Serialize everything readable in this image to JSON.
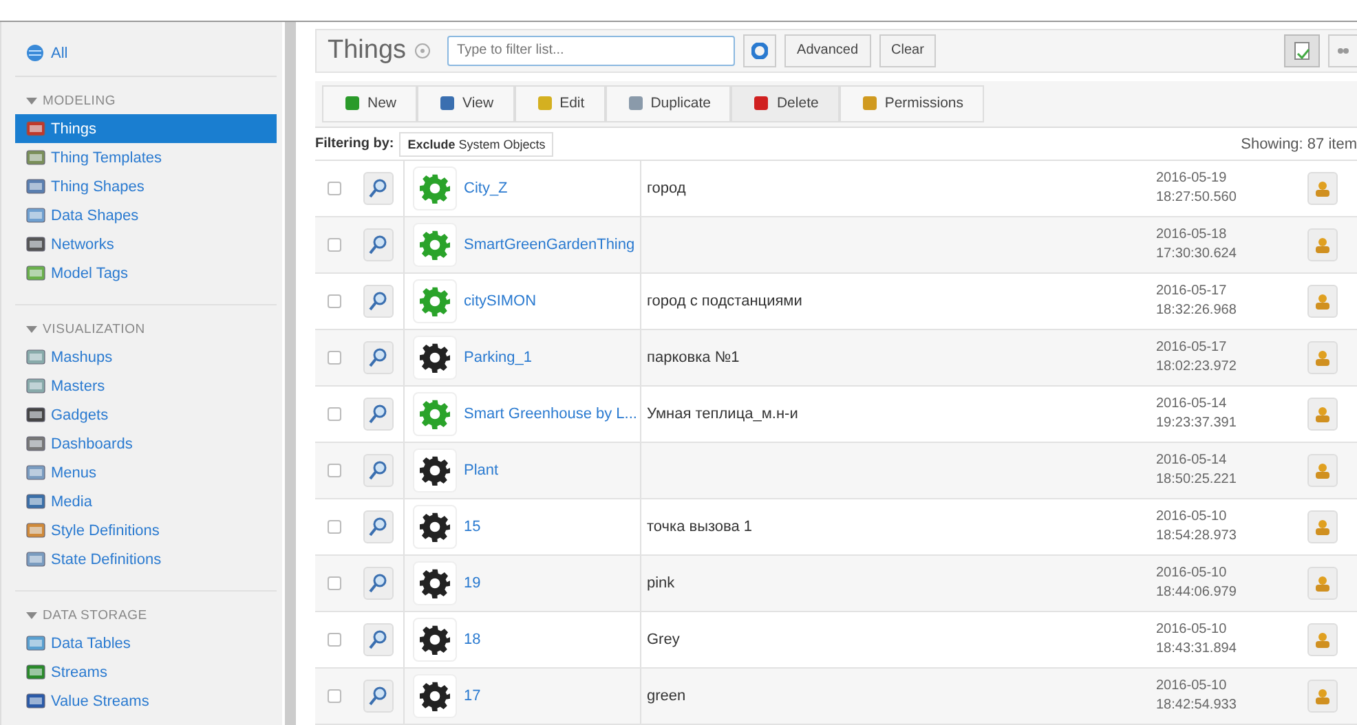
{
  "sidebar": {
    "all_label": "All",
    "sections": [
      {
        "title": "MODELING",
        "items": [
          {
            "label": "Things",
            "selected": true
          },
          {
            "label": "Thing Templates",
            "selected": false
          },
          {
            "label": "Thing Shapes",
            "selected": false
          },
          {
            "label": "Data Shapes",
            "selected": false
          },
          {
            "label": "Networks",
            "selected": false
          },
          {
            "label": "Model Tags",
            "selected": false
          }
        ]
      },
      {
        "title": "VISUALIZATION",
        "items": [
          {
            "label": "Mashups",
            "selected": false
          },
          {
            "label": "Masters",
            "selected": false
          },
          {
            "label": "Gadgets",
            "selected": false
          },
          {
            "label": "Dashboards",
            "selected": false
          },
          {
            "label": "Menus",
            "selected": false
          },
          {
            "label": "Media",
            "selected": false
          },
          {
            "label": "Style Definitions",
            "selected": false
          },
          {
            "label": "State Definitions",
            "selected": false
          }
        ]
      },
      {
        "title": "DATA STORAGE",
        "items": [
          {
            "label": "Data Tables",
            "selected": false
          },
          {
            "label": "Streams",
            "selected": false
          },
          {
            "label": "Value Streams",
            "selected": false
          }
        ]
      }
    ]
  },
  "header": {
    "title": "Things",
    "search": {
      "placeholder": "Type to filter list..."
    },
    "buttons": [
      "Advanced",
      "Clear"
    ]
  },
  "toolbar": [
    "New",
    "View",
    "Edit",
    "Duplicate",
    "Delete",
    "Permissions"
  ],
  "filter": {
    "label": "Filtering by:",
    "tag_bold": "Exclude",
    "tag_rest": "System Objects",
    "count": "Showing: 87 item"
  },
  "rows": [
    {
      "name": "City_Z",
      "color": "#2aa32a",
      "description": "город",
      "modified": "2016-05-19 18:27:50.560",
      "checked": false
    },
    {
      "name": "SmartGreenGardenThing",
      "color": "#2aa32a",
      "description": "",
      "modified": "2016-05-18 17:30:30.624",
      "checked": false
    },
    {
      "name": "citySIMON",
      "color": "#2aa32a",
      "description": "город с подстанциями",
      "modified": "2016-05-17 18:32:26.968",
      "checked": false
    },
    {
      "name": "Parking_1",
      "color": "#222222",
      "description": "парковка №1",
      "modified": "2016-05-17 18:02:23.972",
      "checked": false
    },
    {
      "name": "Smart Greenhouse by L...",
      "color": "#2aa32a",
      "description": "Умная теплица_м.н-и",
      "modified": "2016-05-14 19:23:37.391",
      "checked": false
    },
    {
      "name": "Plant",
      "color": "#222222",
      "description": "",
      "modified": "2016-05-14 18:50:25.221",
      "checked": false
    },
    {
      "name": "15",
      "color": "#222222",
      "description": "точка вызова 1",
      "modified": "2016-05-10 18:54:28.973",
      "checked": false
    },
    {
      "name": "19",
      "color": "#222222",
      "description": "pink",
      "modified": "2016-05-10 18:44:06.979",
      "checked": false
    },
    {
      "name": "18",
      "color": "#222222",
      "description": "Grey",
      "modified": "2016-05-10 18:43:31.894",
      "checked": false
    },
    {
      "name": "17",
      "color": "#222222",
      "description": "green",
      "modified": "2016-05-10 18:42:54.933",
      "checked": false
    }
  ]
}
